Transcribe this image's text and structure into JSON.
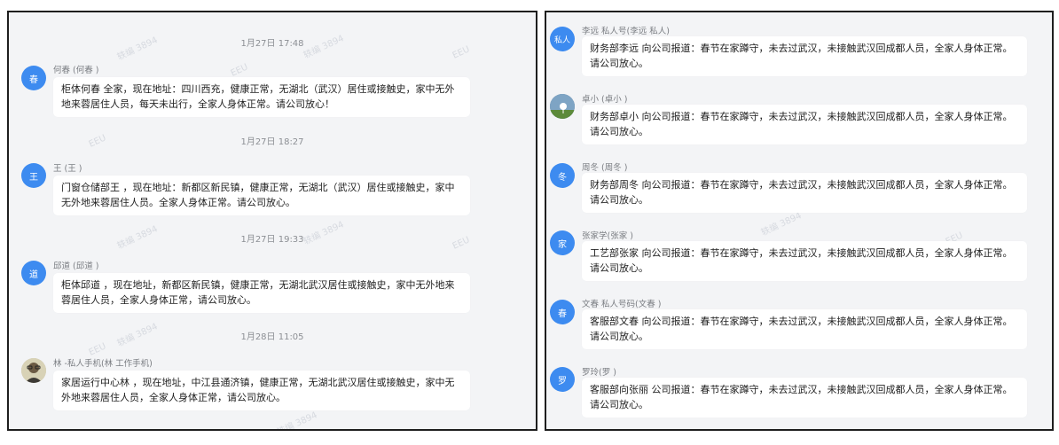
{
  "left": {
    "watermarks": [
      "轶编 3894",
      "EEU"
    ],
    "messages": [
      {
        "timestamp": "1月27日 17:48",
        "avatar": "春",
        "sender": "何春 (何春 )",
        "text": "柜体何春 全家，现在地址：四川西充，健康正常，无湖北（武汉）居住或接触史，家中无外地来蓉居住人员，每天未出行，全家人身体正常。请公司放心！"
      },
      {
        "timestamp": "1月27日 18:27",
        "avatar": "王",
        "sender": "王 (王 )",
        "text": "门窗仓储部王 ，现在地址：新都区新民镇，健康正常，无湖北（武汉）居住或接触史，家中无外地来蓉居住人员。全家人身体正常。请公司放心。"
      },
      {
        "timestamp": "1月27日 19:33",
        "avatar": "道",
        "sender": "邱道 (邱道 )",
        "text": "柜体邱道 ，现在地址，新都区新民镇，健康正常，无湖北武汉居住或接触史，家中无外地来蓉居住人员，全家人身体正常，请公司放心。"
      },
      {
        "timestamp": "1月28日 11:05",
        "avatar": "",
        "sender": "林 -私人手机(林 工作手机)",
        "text": "家居运行中心林 ，现在地址，中江县通济镇，健康正常，无湖北武汉居住或接触史，家中无外地来蓉居住人员，全家人身体正常，请公司放心。"
      }
    ]
  },
  "right": {
    "messages": [
      {
        "avatar": "私人",
        "sender": "李远 私人号(李远 私人)",
        "text": "财务部李远 向公司报道：春节在家蹲守，未去过武汉，未接触武汉回成都人员，全家人身体正常。请公司放心。"
      },
      {
        "avatar": "",
        "sender": "卓小 (卓小 )",
        "text": "财务部卓小 向公司报道：春节在家蹲守，未去过武汉，未接触武汉回成都人员，全家人身体正常。请公司放心。"
      },
      {
        "avatar": "冬",
        "sender": "周冬 (周冬 )",
        "text": "财务部周冬 向公司报道：春节在家蹲守，未去过武汉，未接触武汉回成都人员，全家人身体正常。请公司放心。"
      },
      {
        "avatar": "家",
        "sender": "张家学(张家 )",
        "text": "工艺部张家 向公司报道：春节在家蹲守，未去过武汉，未接触武汉回成都人员，全家人身体正常。请公司放心。"
      },
      {
        "avatar": "春",
        "sender": "文春 私人号码(文春 )",
        "text": "客服部文春 向公司报道：春节在家蹲守，未去过武汉，未接触武汉回成都人员，全家人身体正常。请公司放心。"
      },
      {
        "avatar": "罗",
        "sender": "罗玲(罗 )",
        "text": "客服部向张丽 公司报道：春节在家蹲守，未去过武汉，未接触武汉回成都人员，全家人身体正常。请公司放心。"
      }
    ]
  },
  "colors": {
    "avatar": "#3d8bf0",
    "panel_bg": "#f3f4f6",
    "bubble": "#ffffff"
  }
}
